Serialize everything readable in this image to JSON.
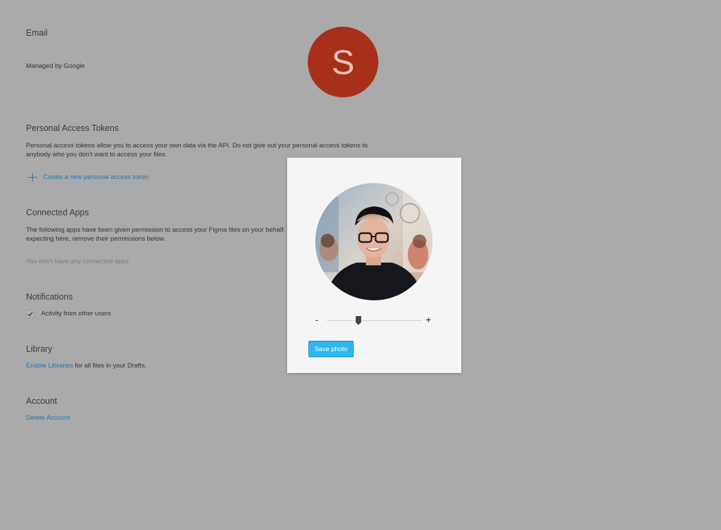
{
  "email": {
    "heading": "Email",
    "managed_by": "Managed by Google"
  },
  "avatar": {
    "initial": "S"
  },
  "tokens": {
    "heading": "Personal Access Tokens",
    "description_line1": "Personal access tokens allow you to access your own data via the API. Do not give out your personal access tokens to",
    "description_line2": "anybody who you don't want to access your files.",
    "create_link": "Create a new personal access token",
    "icon": "plus-icon"
  },
  "connected_apps": {
    "heading": "Connected Apps",
    "description_line1": "The following apps have been given permission to access your Figma files on your behalf. If",
    "description_line2": "expecting here, remove their permissions below.",
    "empty_state": "You don't have any connected apps"
  },
  "notifications": {
    "heading": "Notifications",
    "checkbox_label": "Activity from other users",
    "checked": true
  },
  "library": {
    "heading": "Library",
    "enable_link": "Enable Libraries",
    "suffix_text": " for all files in your Drafts."
  },
  "account": {
    "heading": "Account",
    "delete_link": "Delete Account"
  },
  "photo_modal": {
    "zoom_minus_label": "-",
    "zoom_plus_label": "+",
    "zoom_level": 0.3,
    "save_button_label": "Save photo"
  },
  "colors": {
    "overlay_background": "#aaaaaa",
    "avatar_background": "#a7301a",
    "link": "#1d77b0",
    "save_button": "#2fb6ee"
  }
}
